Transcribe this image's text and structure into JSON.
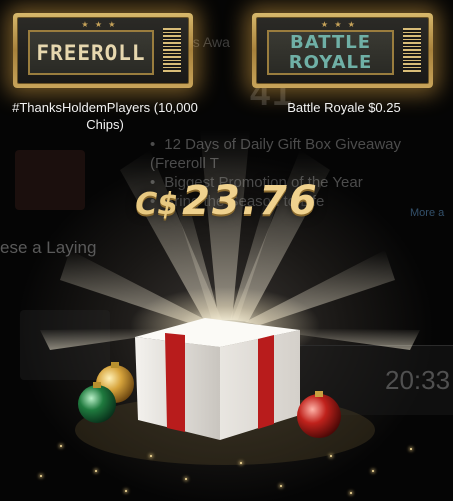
{
  "tickets": [
    {
      "label": "FREEROLL",
      "caption": "#ThanksHoldemPlayers (10,000 Chips)",
      "dots": "★ ★ ★"
    },
    {
      "label_line1": "BATTLE",
      "label_line2": "ROYALE",
      "caption": "Battle Royale $0.25",
      "dots": "★ ★ ★"
    }
  ],
  "prize": {
    "currency": "C$",
    "amount": "23.76"
  },
  "background": {
    "title": "xes Awa",
    "big_number": "41",
    "bullets": [
      "12 Days of Daily Gift Box Giveaway (Freeroll T",
      "Biggest Promotion of the Year",
      "Bring the Season to Life"
    ],
    "left_text": "ese a Laying",
    "more_link": "More a",
    "timer": "20:33"
  },
  "colors": {
    "gold": "#f0d28e",
    "ticket_gold": "#c8a45a",
    "ribbon_red": "#b81c1c",
    "battle_teal": "#6fb0a6"
  }
}
